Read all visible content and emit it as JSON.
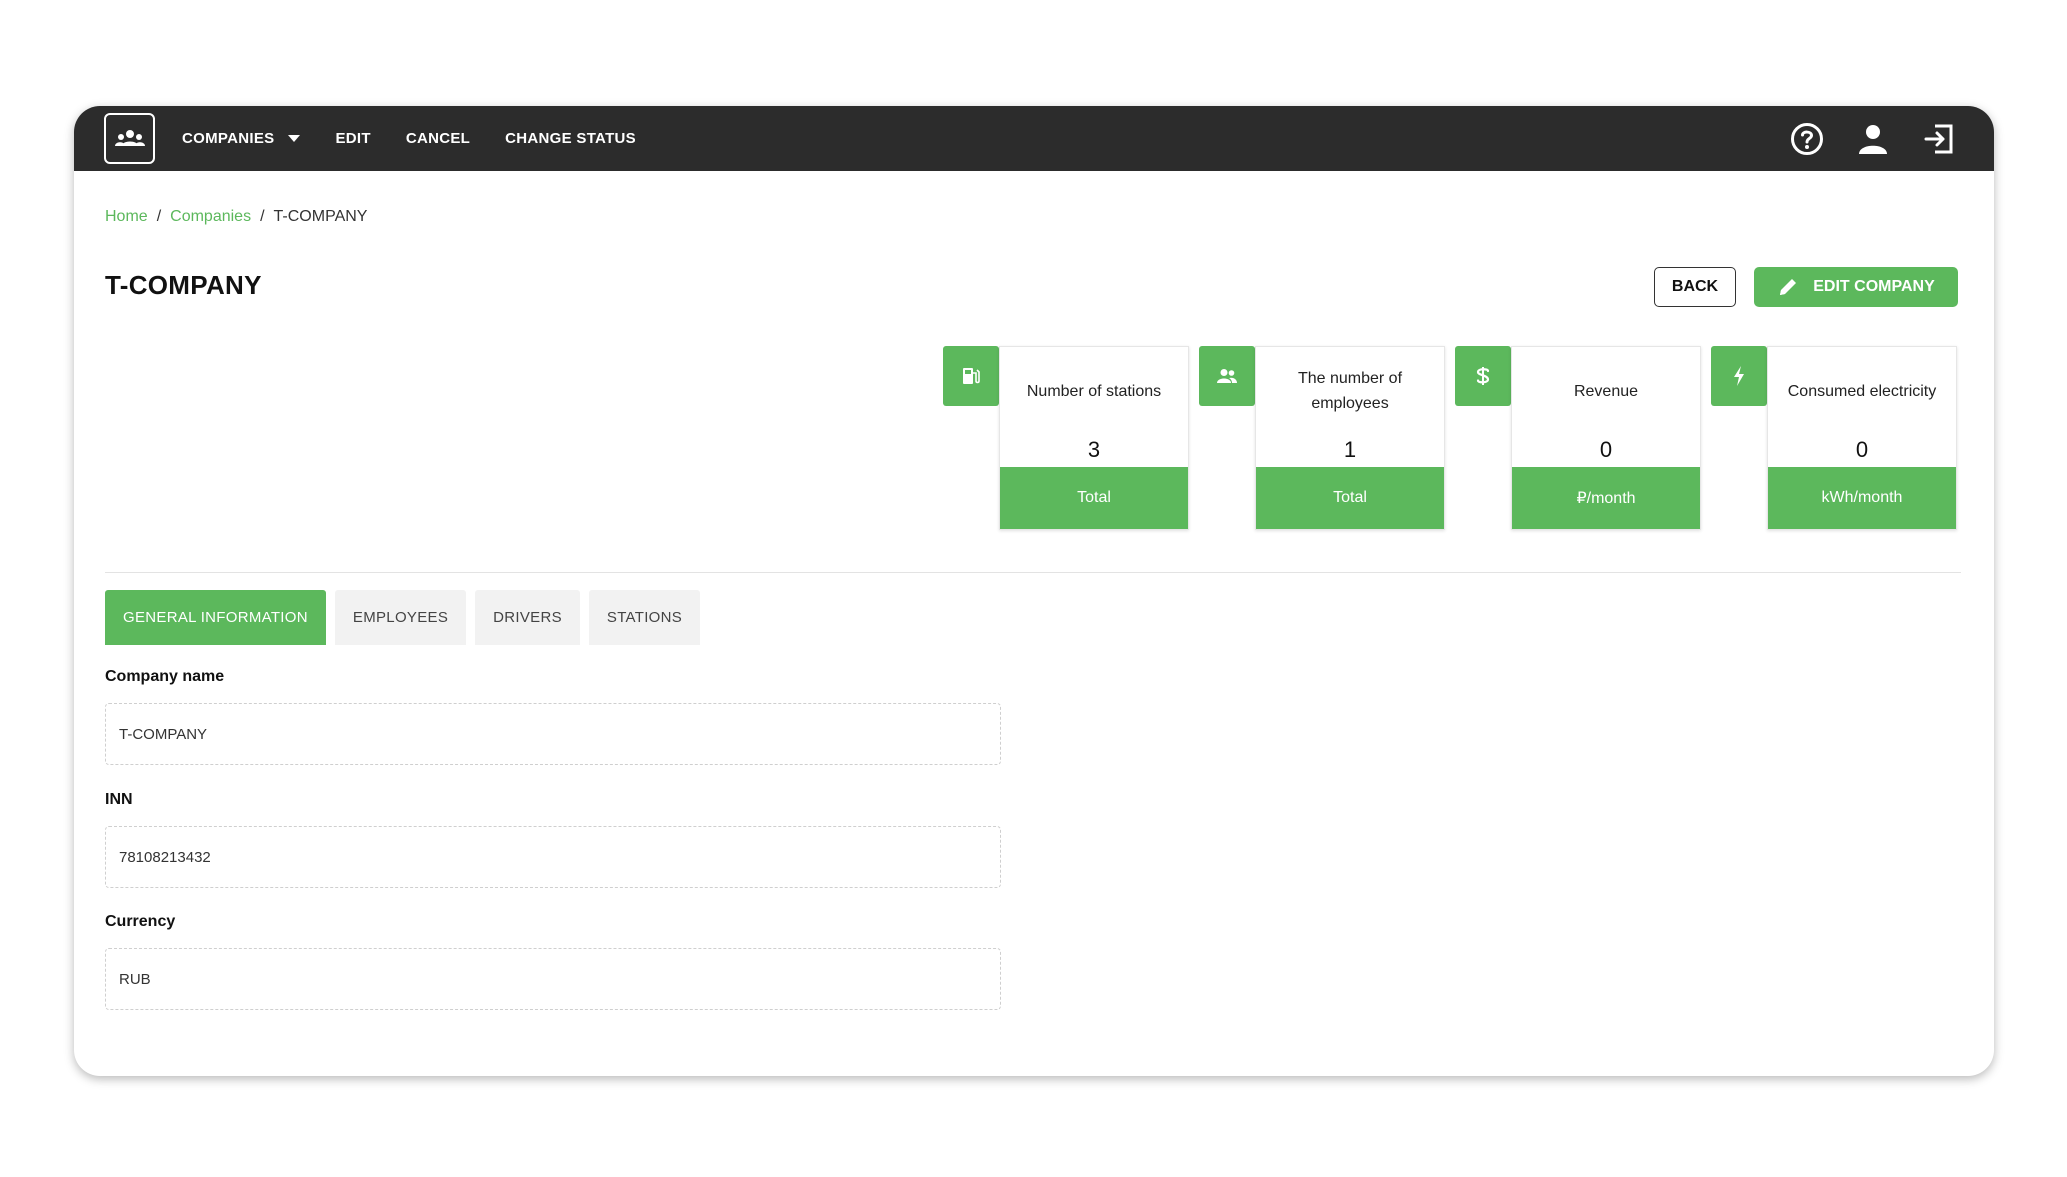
{
  "nav": {
    "companies_label": "COMPANIES",
    "edit_label": "EDIT",
    "cancel_label": "CANCEL",
    "change_status_label": "CHANGE STATUS"
  },
  "breadcrumb": {
    "home": "Home",
    "companies": "Companies",
    "current": "T-COMPANY",
    "separator": "/"
  },
  "page": {
    "title": "T-COMPANY",
    "back_label": "BACK",
    "edit_company_label": "EDIT COMPANY"
  },
  "stats": [
    {
      "icon": "fuel-station-icon",
      "label": "Number of stations",
      "value": "3",
      "footer": "Total"
    },
    {
      "icon": "users-icon",
      "label": "The number of employees",
      "value": "1",
      "footer": "Total"
    },
    {
      "icon": "dollar-icon",
      "label": "Revenue",
      "value": "0",
      "footer": "₽/month"
    },
    {
      "icon": "lightning-icon",
      "label": "Consumed electricity",
      "value": "0",
      "footer": "kWh/month"
    }
  ],
  "tabs": [
    "GENERAL INFORMATION",
    "EMPLOYEES",
    "DRIVERS",
    "STATIONS"
  ],
  "active_tab": "GENERAL INFORMATION",
  "form": {
    "company_name_label": "Company name",
    "company_name_value": "T-COMPANY",
    "inn_label": "INN",
    "inn_value": "78108213432",
    "currency_label": "Currency",
    "currency_value": "RUB"
  },
  "colors": {
    "accent": "#5cb85c",
    "topbar": "#2c2c2c"
  }
}
